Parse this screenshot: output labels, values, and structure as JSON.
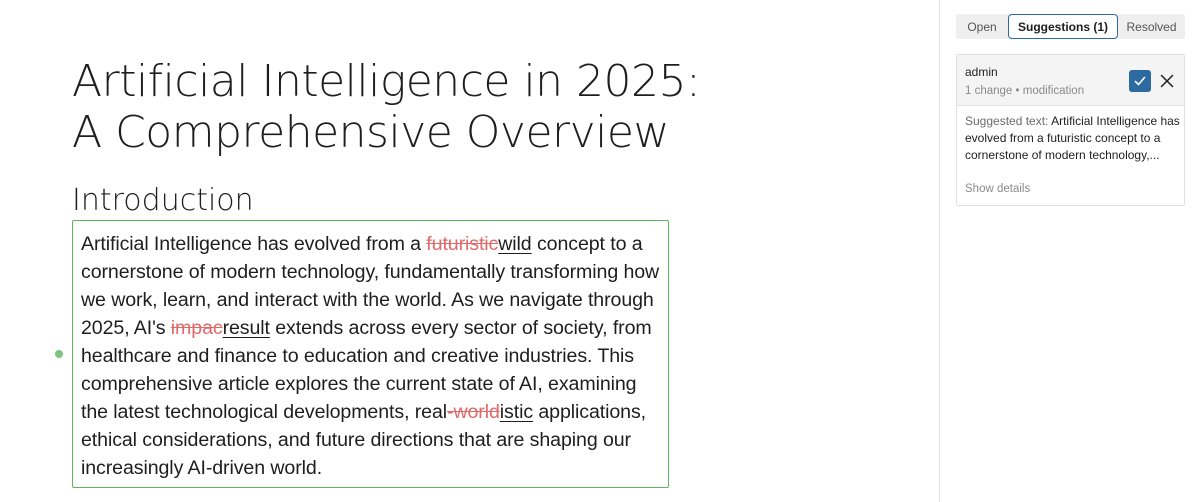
{
  "document": {
    "title_line1": "Artificial Intelligence in 2025:",
    "title_line2": "A Comprehensive Overview",
    "section_heading": "Introduction",
    "paragraph": {
      "p1": "Artificial Intelligence has evolved from a ",
      "del1": "futuristic",
      "ins1": "wild",
      "p2": " concept to a cornerstone of modern technology, fundamentally transforming how we work, learn, and interact with the world. As we navigate through 2025, AI's ",
      "del2": "impac",
      "ins2": "result",
      "p3": " extends across every sector of society, from healthcare and finance to education and creative industries. This comprehensive article explores the current state of AI, examining the latest technological developments, real",
      "del3": "-world",
      "ins3": "istic",
      "p4": " applications, ethical considerations, and future directions that are shaping our increasingly AI-driven world."
    }
  },
  "sidebar": {
    "tabs": [
      {
        "label": "Open"
      },
      {
        "label": "Suggestions (1)"
      },
      {
        "label": "Resolved"
      }
    ],
    "active_tab": "Suggestions (1)",
    "suggestion": {
      "author": "admin",
      "meta": "1 change • modification",
      "label": "Suggested text:",
      "text": "Artificial Intelligence has evolved from a futuristic concept to a cornerstone of modern technology,...",
      "show_details": "Show details"
    }
  },
  "colors": {
    "accent": "#2c6aa0",
    "block_border": "#5eb35e",
    "deletion": "#e06a6a"
  },
  "icons": {
    "accept": "check-icon",
    "reject": "close-icon"
  }
}
